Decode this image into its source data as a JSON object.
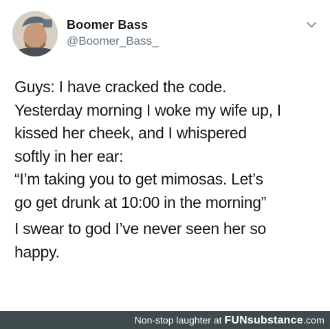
{
  "author": {
    "name": "Boomer Bass",
    "handle": "@Boomer_Bass_"
  },
  "icons": {
    "avatar": "profile-photo",
    "menu": "chevron-down-icon"
  },
  "tweet": {
    "paragraph1": [
      "Guys: I have cracked the code.",
      "Yesterday morning I woke my wife up, I",
      "kissed her cheek, and I whispered",
      "softly in her ear:",
      "“I’m taking you to get mimosas. Let’s",
      "go get drunk at 10:00 in the morning”"
    ],
    "paragraph2": [
      "I swear to god I’ve never seen her so",
      "happy."
    ]
  },
  "footer": {
    "prefix": "Non-stop laughter at",
    "brand": "FUNsubstance",
    "suffix": ".com"
  },
  "colors": {
    "text": "#14171a",
    "handle": "#657786",
    "footer_bg": "#3f4a4d"
  }
}
